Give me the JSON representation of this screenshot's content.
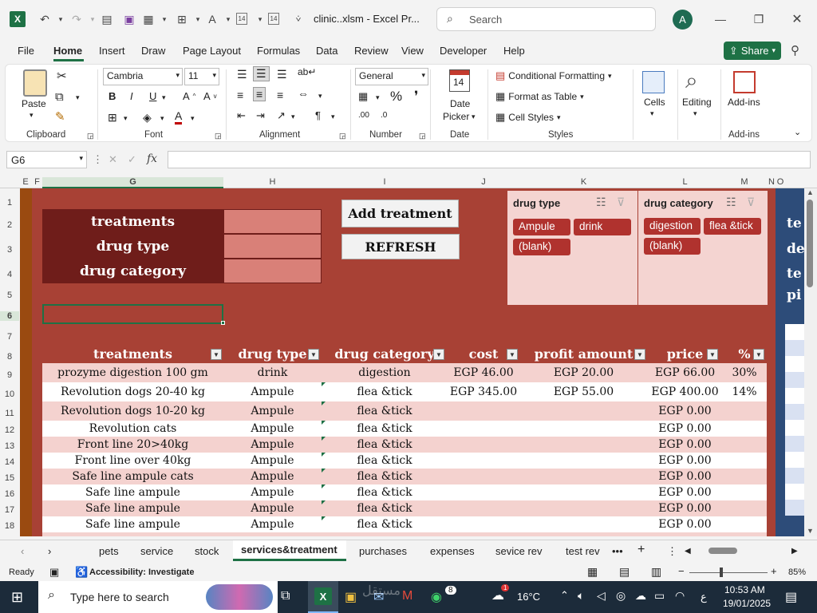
{
  "titlebar": {
    "filename": "clinic..xlsm - Excel Pr...",
    "search_placeholder": "Search",
    "avatar_initial": "A",
    "date_icon_number": "14"
  },
  "ribbon_tabs": [
    "File",
    "Home",
    "Insert",
    "Draw",
    "Page Layout",
    "Formulas",
    "Data",
    "Review",
    "View",
    "Developer",
    "Help"
  ],
  "share_label": "Share",
  "ribbon": {
    "paste": "Paste",
    "clipboard": "Clipboard",
    "font_name": "Cambria",
    "font_size": "11",
    "font_group": "Font",
    "alignment": "Alignment",
    "number_format": "General",
    "number": "Number",
    "date_picker_line1": "Date",
    "date_picker_line2": "Picker",
    "date_group": "Date",
    "date_num": "14",
    "conditional_formatting": "Conditional Formatting",
    "format_as_table": "Format as Table",
    "cell_styles": "Cell Styles",
    "styles": "Styles",
    "cells": "Cells",
    "editing": "Editing",
    "add_ins": "Add-ins",
    "add_ins_group": "Add-ins"
  },
  "formula_bar": {
    "name_box": "G6",
    "fx": "fx",
    "value": ""
  },
  "columns": [
    "E",
    "F",
    "G",
    "H",
    "I",
    "J",
    "K",
    "L",
    "M",
    "N",
    "O"
  ],
  "rows": [
    "1",
    "2",
    "3",
    "4",
    "5",
    "6",
    "7",
    "8",
    "9",
    "10",
    "11",
    "12",
    "13",
    "14",
    "15",
    "16",
    "17",
    "18"
  ],
  "form": {
    "label_treatments": "treatments",
    "label_drug_type": "drug type",
    "label_drug_category": "drug category"
  },
  "buttons": {
    "add_treatment": "Add treatment",
    "refresh": "REFRESH"
  },
  "slicers": {
    "drug_type": {
      "title": "drug type",
      "items": [
        "Ampule",
        "drink",
        "(blank)"
      ]
    },
    "drug_category": {
      "title": "drug category",
      "items": [
        "digestion",
        "flea &tick",
        "(blank)"
      ]
    }
  },
  "right_pane_letters": [
    "te",
    "de",
    "te",
    "pi"
  ],
  "table": {
    "headers": [
      "treatments",
      "drug type",
      "drug category",
      "cost",
      "profit amount",
      "price",
      "%"
    ],
    "rows": [
      [
        "prozyme digestion 100 gm",
        "drink",
        "digestion",
        "EGP 46.00",
        "EGP 20.00",
        "EGP 66.00",
        "30%"
      ],
      [
        "Revolution dogs 20-40 kg",
        "Ampule",
        "flea &tick",
        "EGP 345.00",
        "EGP 55.00",
        "EGP 400.00",
        "14%"
      ],
      [
        "Revolution dogs 10-20 kg",
        "Ampule",
        "flea &tick",
        "",
        "",
        "EGP 0.00",
        ""
      ],
      [
        "Revolution cats",
        "Ampule",
        "flea &tick",
        "",
        "",
        "EGP 0.00",
        ""
      ],
      [
        "Front line 20>40kg",
        "Ampule",
        "flea &tick",
        "",
        "",
        "EGP 0.00",
        ""
      ],
      [
        "Front line over 40kg",
        "Ampule",
        "flea &tick",
        "",
        "",
        "EGP 0.00",
        ""
      ],
      [
        "Safe line ampule cats",
        "Ampule",
        "flea &tick",
        "",
        "",
        "EGP 0.00",
        ""
      ],
      [
        "Safe line ampule",
        "Ampule",
        "flea &tick",
        "",
        "",
        "EGP 0.00",
        ""
      ],
      [
        "Safe line ampule",
        "Ampule",
        "flea &tick",
        "",
        "",
        "EGP 0.00",
        ""
      ],
      [
        "Safe line ampule",
        "Ampule",
        "flea &tick",
        "",
        "",
        "EGP 0.00",
        ""
      ]
    ]
  },
  "sheet_tabs": [
    "pets",
    "service",
    "stock",
    "services&treatment",
    "purchases",
    "expenses",
    "sevice rev",
    "test rev"
  ],
  "active_sheet": "services&treatment",
  "status": {
    "ready": "Ready",
    "accessibility": "Accessibility: Investigate",
    "zoom": "85%"
  },
  "taskbar": {
    "search_placeholder": "Type here to search",
    "weather": "16°C",
    "time": "10:53 AM",
    "date": "19/01/2025",
    "badge_count": "8",
    "lang": "ع",
    "notif": "1",
    "watermark": "مستقل"
  },
  "colors": {
    "sheet_bg": "#a84135",
    "dark_cell": "#6f1d1a",
    "pink_cell": "#d98078",
    "row_light": "#f4d2cf",
    "row_white": "#ffffff",
    "slicer_bg": "#f4d4d1",
    "slicer_item": "#b0322e",
    "excel_green": "#1e7145"
  }
}
